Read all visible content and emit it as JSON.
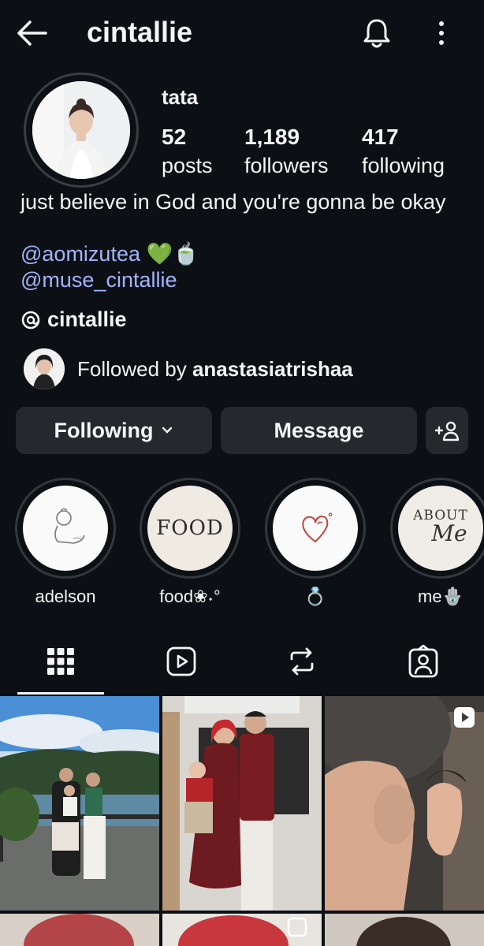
{
  "header": {
    "username": "cintallie"
  },
  "profile": {
    "display_name": "tata",
    "posts_count": "52",
    "posts_label": "posts",
    "followers_count": "1,189",
    "followers_label": "followers",
    "following_count": "417",
    "following_label": "following",
    "bio_text": "just believe in God and you're gonna be okay",
    "mention_1": "@aomizutea 💚🍵",
    "mention_2": "@muse_cintallie",
    "threads_handle": "cintallie",
    "followed_by_prefix": "Followed by",
    "followed_by_name": "anastasiatrishaa"
  },
  "actions": {
    "following_label": "Following",
    "message_label": "Message"
  },
  "highlights": [
    {
      "label": "adelson"
    },
    {
      "label": "food❀˖°",
      "cover_text": "FOOD"
    },
    {
      "label": "💍"
    },
    {
      "label": "me🪬",
      "cover_line_1": "ABOUT",
      "cover_line_2": "Me"
    }
  ],
  "tabs": [
    {
      "name": "grid",
      "icon": "grid-icon",
      "active": true
    },
    {
      "name": "reels",
      "icon": "reels-icon",
      "active": false
    },
    {
      "name": "reposts",
      "icon": "repost-icon",
      "active": false
    },
    {
      "name": "tagged",
      "icon": "tagged-icon",
      "active": false
    }
  ],
  "colors": {
    "background": "#0c1014",
    "button_bg": "#25292e",
    "link": "#a3b4ff",
    "heart_green": "#22c55e"
  }
}
